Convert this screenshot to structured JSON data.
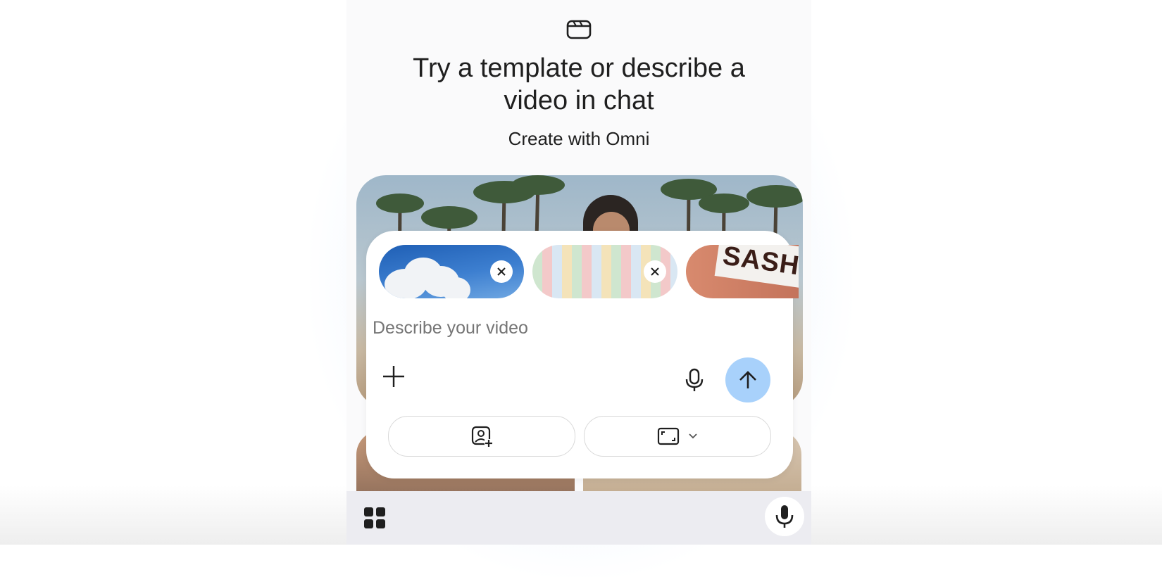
{
  "header": {
    "icon": "clapperboard-icon",
    "title": "Try a template or describe a\nvideo in chat",
    "subtitle": "Create with Omni"
  },
  "hero": {
    "image": "beach-palm-trees-person"
  },
  "composer": {
    "attachments": [
      {
        "image": "blue-sky-cloud",
        "removable": true
      },
      {
        "image": "illustrated-street",
        "removable": true
      },
      {
        "image": "sash-arm-photo",
        "removable": false,
        "text": "SASH"
      }
    ],
    "prompt": {
      "placeholder": "Describe your video",
      "value": ""
    },
    "buttons": {
      "add": "plus-icon",
      "voice": "microphone-icon",
      "send": "arrow-up-icon",
      "image": "add-photo-icon",
      "aspect": "aspect-ratio-icon"
    }
  },
  "bottom_bar": {
    "apps": "grid-icon",
    "voice": "microphone-icon"
  },
  "colors": {
    "send_button": "#a8d1fb",
    "text": "#1f1f1f",
    "placeholder": "#8a8a8a",
    "bottom_bar": "#ececf1"
  }
}
